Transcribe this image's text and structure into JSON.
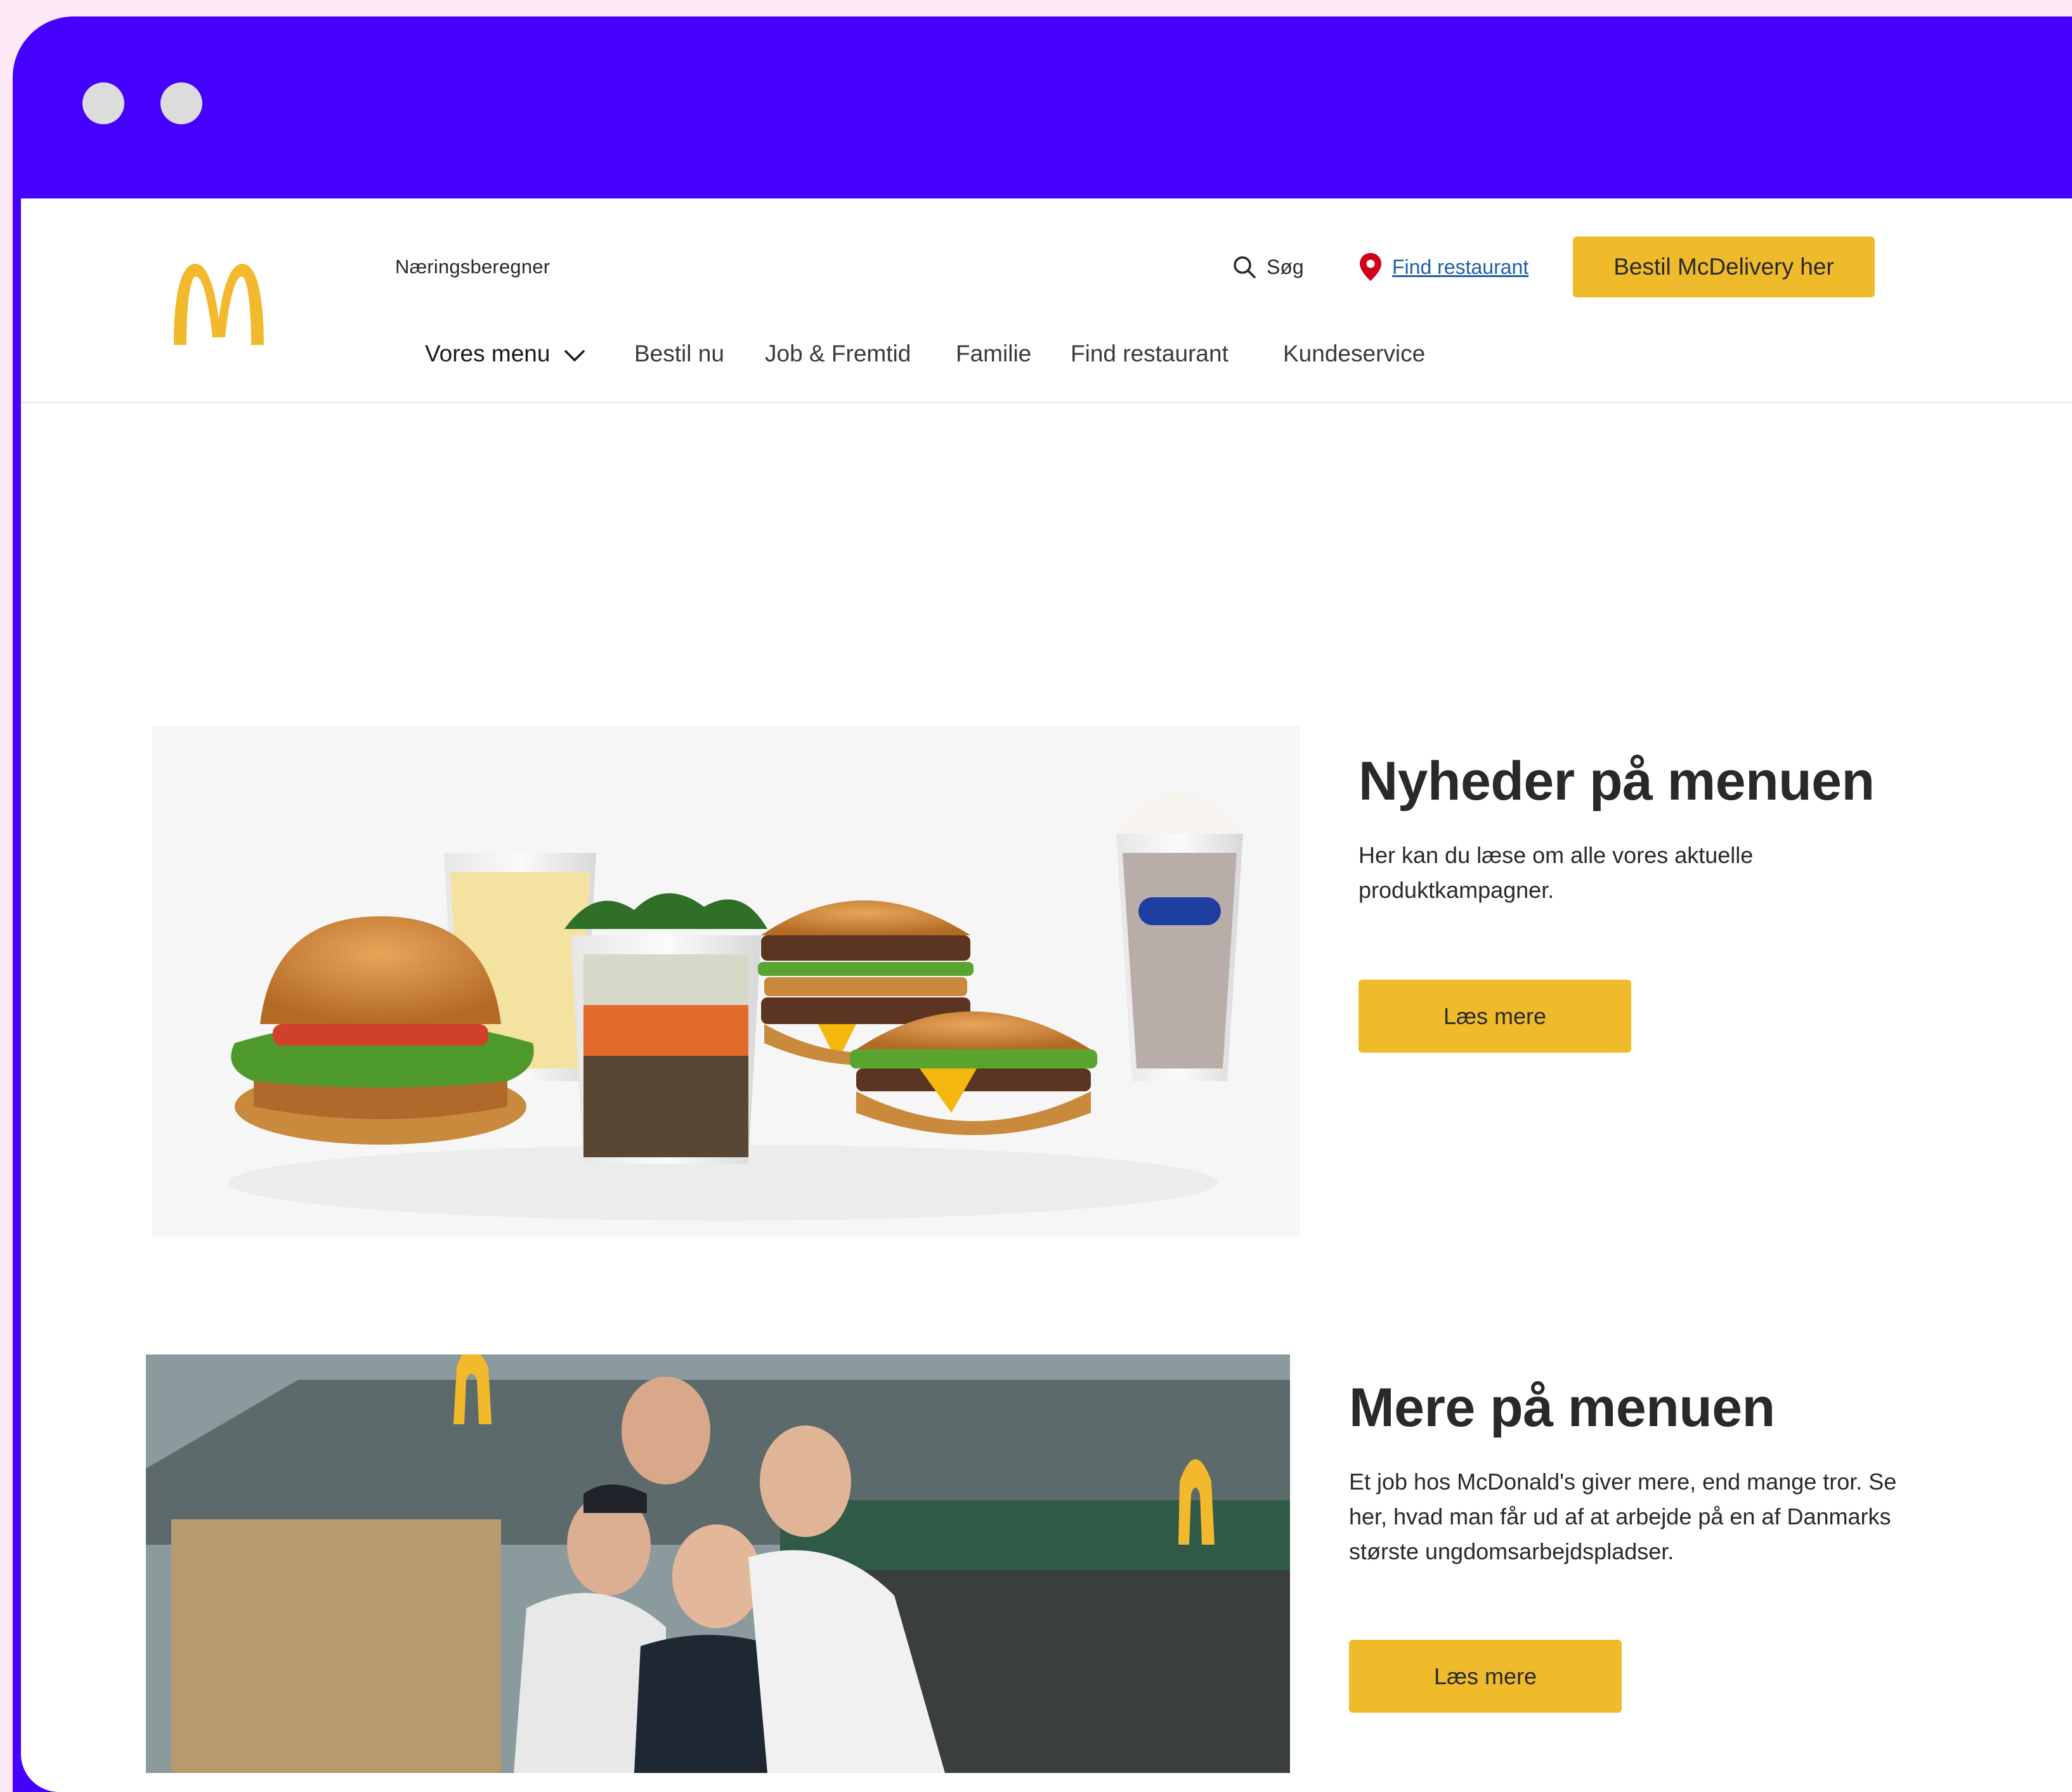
{
  "header": {
    "utility_link": "Næringsberegner",
    "search_label": "Søg",
    "find_restaurant_link": "Find restaurant",
    "delivery_button": "Bestil McDelivery her"
  },
  "nav": {
    "items": [
      {
        "label": "Vores menu",
        "has_dropdown": true
      },
      {
        "label": "Bestil nu"
      },
      {
        "label": "Job & Fremtid"
      },
      {
        "label": "Familie"
      },
      {
        "label": "Find restaurant"
      },
      {
        "label": "Kundeservice"
      }
    ]
  },
  "sections": [
    {
      "title": "Nyheder på menuen",
      "text": "Her kan du læse om alle vores aktuelle produktkampagner.",
      "button": "Læs mere",
      "image": "menu-products-photo"
    },
    {
      "title": "Mere på menuen",
      "text": "Et job hos McDonald's giver mere, end mange tror. Se her, hvad man får ud af at arbejde på en af Danmarks største ungdomsarbejdspladser.",
      "button": "Læs mere",
      "image": "employees-photo"
    }
  ],
  "colors": {
    "frame": "#4600ff",
    "accent_yellow": "#efbb2b",
    "logo_yellow": "#f2b92c",
    "link_blue": "#1f5fa8",
    "pin_red": "#d0021b",
    "background_pink": "#fde8f6"
  },
  "icons": {
    "search": "search-icon",
    "location": "location-pin-icon",
    "dropdown": "chevron-down-icon",
    "logo": "golden-arches-logo"
  }
}
